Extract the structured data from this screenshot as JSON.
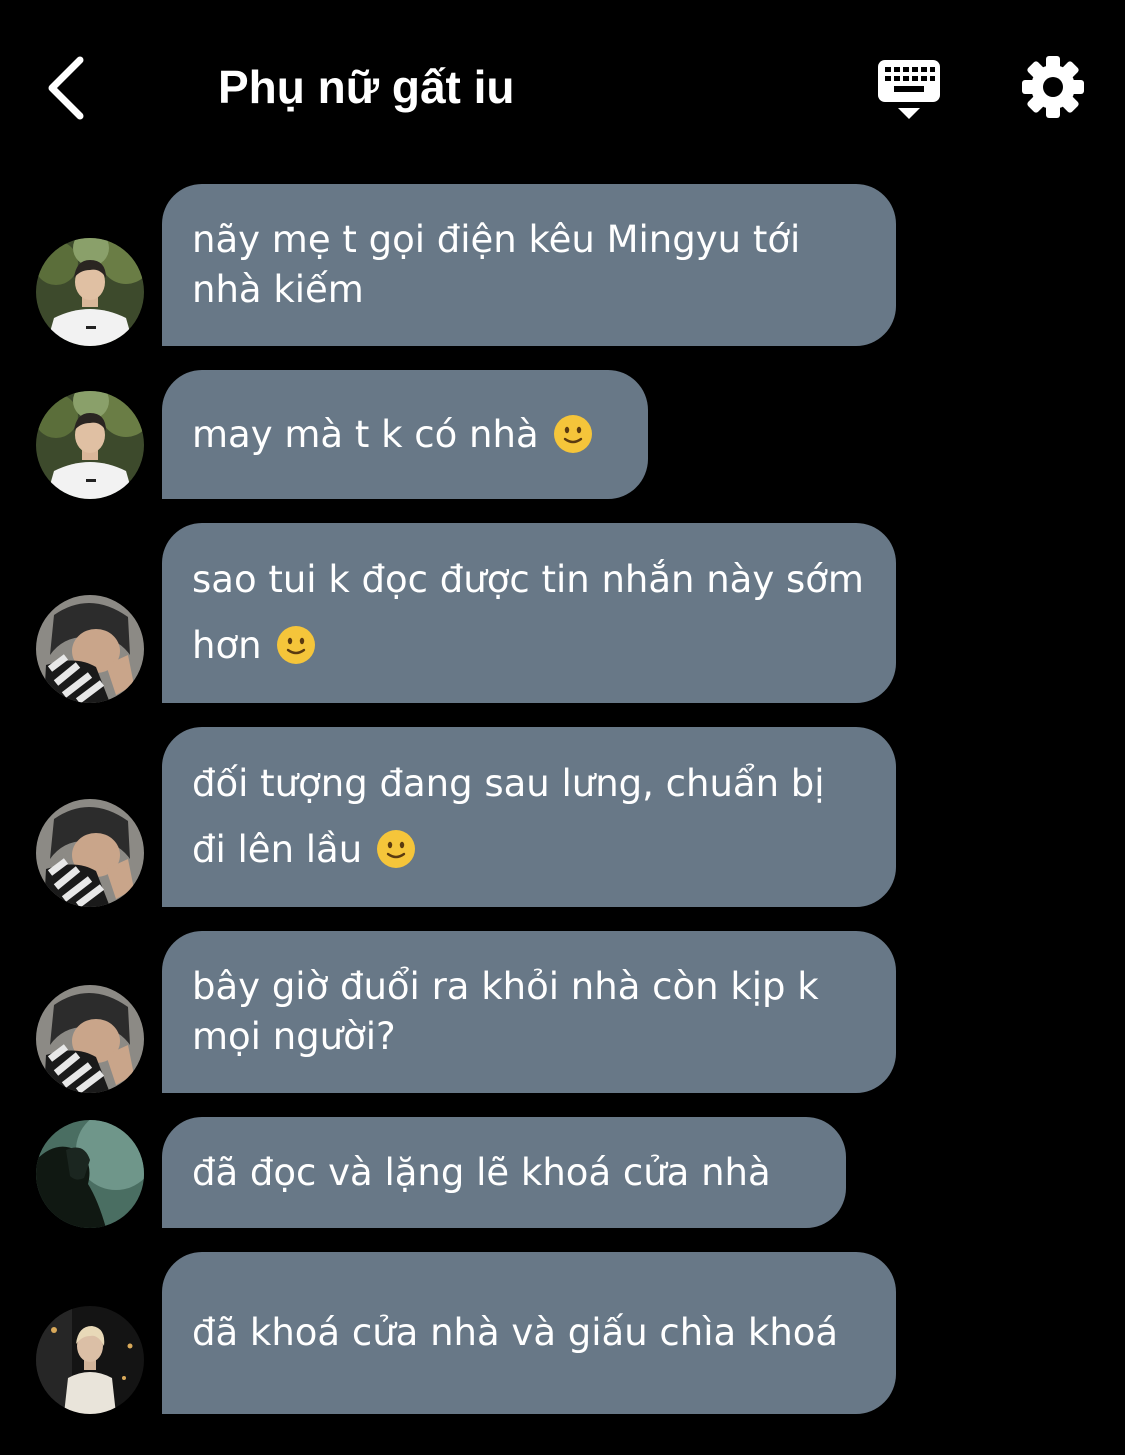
{
  "header": {
    "title": "Phụ nữ gất iu",
    "back_icon": "chevron-left-icon",
    "keyboard_icon": "keyboard-icon",
    "settings_icon": "gear-icon"
  },
  "colors": {
    "background": "#000000",
    "bubble": "#687887",
    "text": "#ffffff"
  },
  "messages": [
    {
      "text": "nãy mẹ t gọi điện kêu Mingyu tới nhà kiếm",
      "emoji": null,
      "avatar": "avatar-white-tshirt"
    },
    {
      "text": "may mà t k có nhà",
      "emoji": "slight-smile",
      "avatar": "avatar-white-tshirt"
    },
    {
      "text": "sao tui k đọc được tin nhắn này sớm hơn",
      "emoji": "slight-smile",
      "avatar": "avatar-covered-face"
    },
    {
      "text": "đối tượng đang sau lưng, chuẩn bị đi lên lầu",
      "emoji": "slight-smile",
      "avatar": "avatar-covered-face"
    },
    {
      "text": "bây giờ đuổi ra khỏi nhà còn kịp k mọi người?",
      "emoji": null,
      "avatar": "avatar-covered-face"
    },
    {
      "text": "đã đọc và lặng lẽ khoá cửa nhà",
      "emoji": null,
      "avatar": "avatar-dark-profile"
    },
    {
      "text": "đã khoá cửa nhà và giấu chìa khoá",
      "emoji": null,
      "avatar": "avatar-blond-jacket"
    }
  ]
}
